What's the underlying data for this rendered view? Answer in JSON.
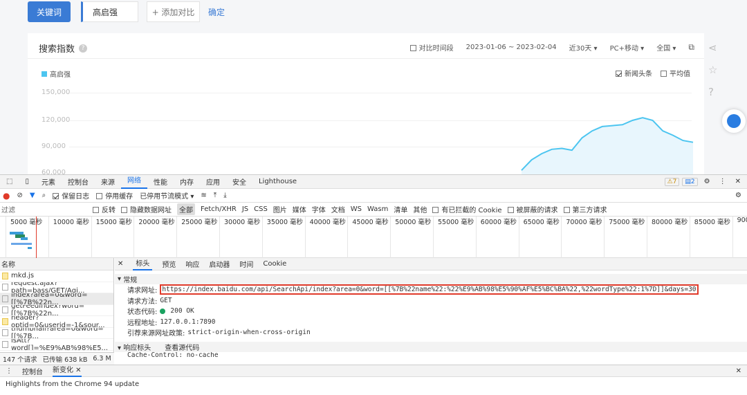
{
  "top": {
    "keyword_button": "关键词",
    "keyword": "高启强",
    "add_compare": "+ 添加对比",
    "confirm": "确定"
  },
  "panel": {
    "title": "搜索指数",
    "compare_period": "对比时间段",
    "date_range": "2023-01-06 ~ 2023-02-04",
    "period": "近30天",
    "device": "PC+移动",
    "region": "全国",
    "legend": "高启强",
    "news": "新闻头条",
    "average": "平均值",
    "y_ticks": [
      "150,000",
      "120,000",
      "90,000",
      "60,000"
    ]
  },
  "chart_data": {
    "type": "area",
    "series": [
      {
        "name": "高启强",
        "values": [
          63000,
          75000,
          82000,
          87000,
          88000,
          86000,
          100000,
          108000,
          113000,
          114000,
          115000,
          120000,
          123000,
          120000,
          108000,
          103000,
          97000,
          95000
        ]
      }
    ],
    "y_ticks": [
      150000,
      120000,
      90000,
      60000
    ]
  },
  "devtools": {
    "tabs": [
      "元素",
      "控制台",
      "来源",
      "网络",
      "性能",
      "内存",
      "应用",
      "安全",
      "Lighthouse"
    ],
    "active_tab": "网络",
    "warn_count": "7",
    "msg_count": "2",
    "tb2": {
      "preserve_log": "保留日志",
      "disable_cache": "停用缓存",
      "throttle": "已停用节流模式"
    },
    "filter_placeholder": "过滤",
    "filter_opts": [
      "反转",
      "隐藏数据网址"
    ],
    "types": [
      "全部",
      "Fetch/XHR",
      "JS",
      "CSS",
      "图片",
      "媒体",
      "字体",
      "文档",
      "WS",
      "Wasm",
      "清单",
      "其他"
    ],
    "blocked": [
      "有已拦截的 Cookie",
      "被屏蔽的请求",
      "第三方请求"
    ],
    "timeline": [
      "5000 毫秒",
      "10000 毫秒",
      "15000 毫秒",
      "20000 毫秒",
      "25000 毫秒",
      "30000 毫秒",
      "35000 毫秒",
      "40000 毫秒",
      "45000 毫秒",
      "50000 毫秒",
      "55000 毫秒",
      "60000 毫秒",
      "65000 毫秒",
      "70000 毫秒",
      "75000 毫秒",
      "80000 毫秒",
      "85000 毫秒",
      "900"
    ],
    "name_header": "名称",
    "requests": [
      "mkd.js",
      "request.ajax?path=bass/GET/Agi...",
      "index?area=0&word=[[%7B%22n...",
      "getFeedIndex?word=[[%7B%22n...",
      "header?optid=0&userid=-1&sour...",
      "thumbnail?area=0&word=[[%7B...",
      "isAtt?word[]=%E9%AB%98%E5..."
    ],
    "status": {
      "count": "147 个请求",
      "transferred": "已传输 638 kB",
      "size": "6.3 M"
    },
    "detail_tabs": [
      "标头",
      "预览",
      "响应",
      "启动器",
      "时间",
      "Cookie"
    ],
    "general": "常规",
    "url_label": "请求网址:",
    "url": "https://index.baidu.com/api/SearchApi/index?area=0&word=[[%7B%22name%22:%22%E9%AB%98%E5%90%AF%E5%BC%BA%22,%22wordType%22:1%7D]]&days=30",
    "method_label": "请求方法:",
    "method": "GET",
    "status_label": "状态代码:",
    "status_code": "200 OK",
    "remote_label": "远程地址:",
    "remote": "127.0.0.1:7890",
    "referrer_label": "引荐来源网址政策:",
    "referrer": "strict-origin-when-cross-origin",
    "resp_headers": "响应标头",
    "view_source": "查看源代码",
    "cache_control": "Cache-Control: no-cache",
    "drawer_tabs": [
      "控制台",
      "新变化"
    ],
    "highlights": "Highlights from the Chrome 94 update"
  }
}
